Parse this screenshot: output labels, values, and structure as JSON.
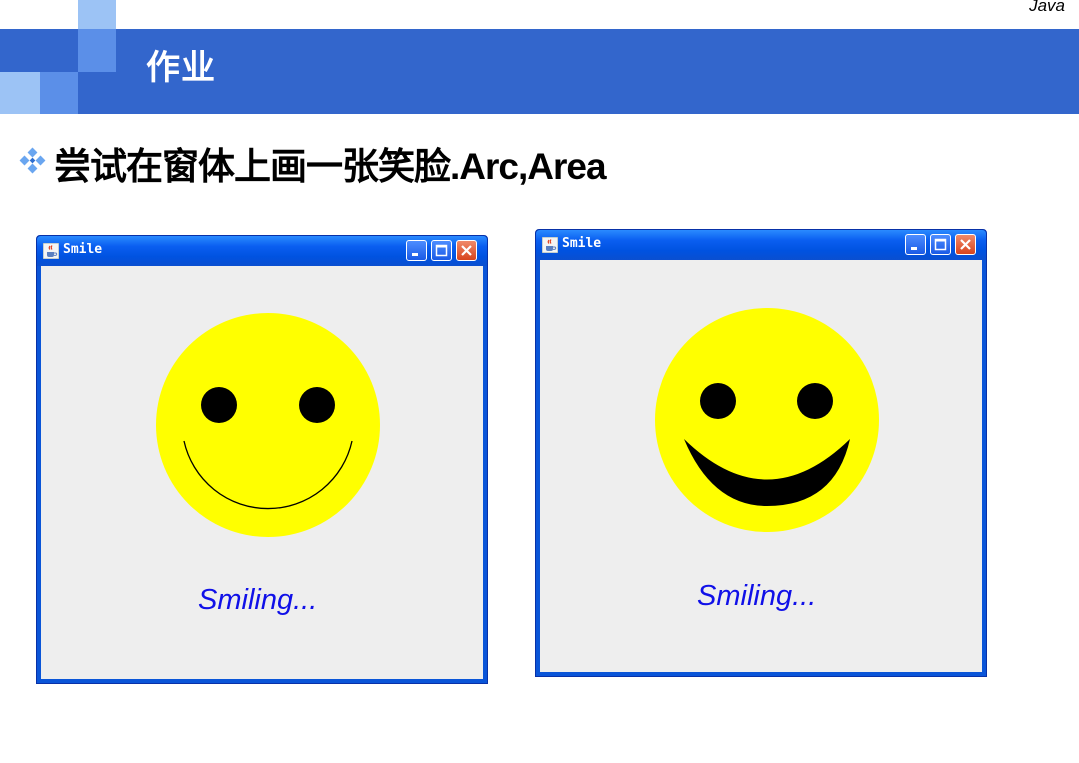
{
  "slide": {
    "brand": "Java",
    "title": "作业",
    "bullet_text": "尝试在窗体上画一张笑脸.Arc,Area"
  },
  "windows": [
    {
      "title": "Smile",
      "caption": "Smiling...",
      "mouth_style": "arc"
    },
    {
      "title": "Smile",
      "caption": "Smiling...",
      "mouth_style": "filled-area"
    }
  ],
  "colors": {
    "header_bar": "#3366cc",
    "face": "#ffff00",
    "caption": "#1010e8",
    "window_frame": "#0a55d8",
    "client_background": "#eeeeee"
  },
  "icons": {
    "bullet": "diamond-cluster-icon",
    "window": "java-coffee-cup-icon",
    "minimize": "minimize-icon",
    "maximize": "maximize-icon",
    "close": "close-icon"
  }
}
